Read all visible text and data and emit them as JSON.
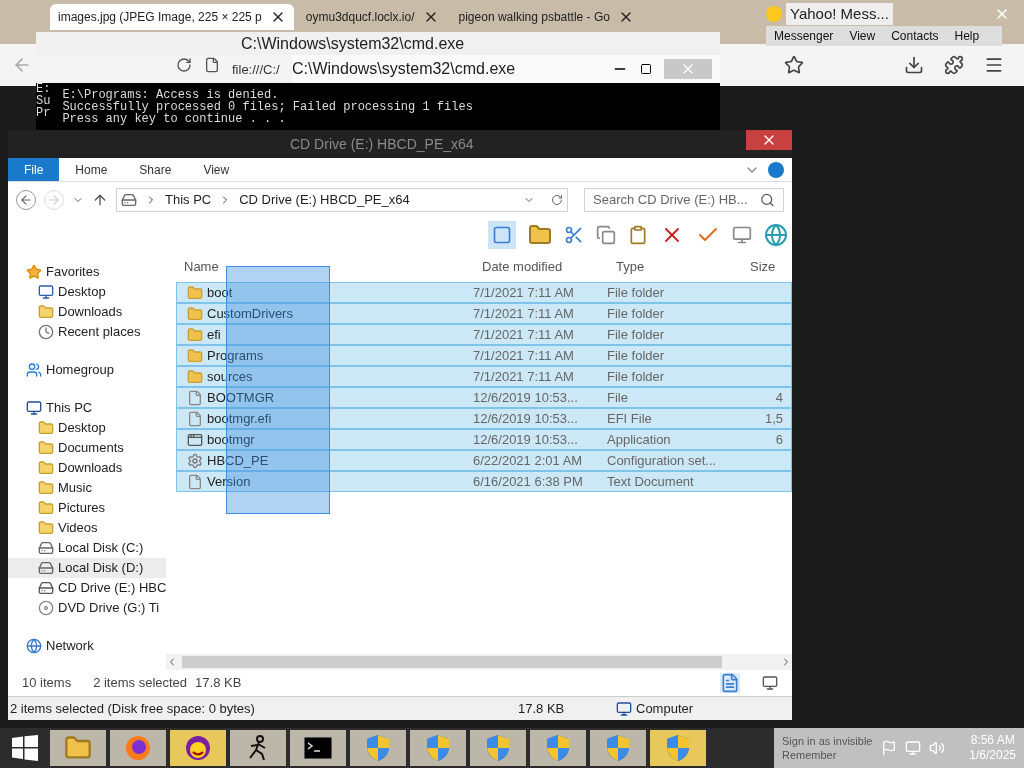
{
  "browser": {
    "tabs": [
      {
        "label": "images.jpg (JPEG Image, 225 × 225 p",
        "selected": true
      },
      {
        "label": "oymu3dqucf.loclx.io/",
        "selected": false
      },
      {
        "label": "pigeon walking psbattle - Go",
        "selected": false
      }
    ],
    "address": "file:///C:/"
  },
  "messenger": {
    "title": "Yahoo! Mess...",
    "menu": [
      "Messenger",
      "View",
      "Contacts",
      "Help"
    ]
  },
  "console_windows": [
    {
      "title": "C:\\Windows\\system32\\cmd.exe"
    },
    {
      "title": "C:\\Windows\\system32\\cmd.exe"
    }
  ],
  "console": {
    "hidden_lines": [
      "E:",
      "Su",
      "Pr"
    ],
    "lines": [
      "E:\\Programs: Access is denied.",
      "Successfully processed 0 files; Failed processing 1 files",
      "Press any key to continue . . ."
    ]
  },
  "explorer": {
    "title": "CD Drive (E:) HBCD_PE_x64",
    "ribbon_tabs": [
      {
        "label": "File",
        "selected": true
      },
      {
        "label": "Home",
        "selected": false
      },
      {
        "label": "Share",
        "selected": false
      },
      {
        "label": "View",
        "selected": false
      }
    ],
    "breadcrumb": [
      "This PC",
      "CD Drive (E:) HBCD_PE_x64"
    ],
    "search": {
      "placeholder": "Search CD Drive (E:) HB..."
    },
    "sidebar": [
      {
        "label": "Favorites",
        "kind": "star",
        "selected": false,
        "children": [
          {
            "label": "Desktop",
            "kind": "desktop",
            "selected": false
          },
          {
            "label": "Downloads",
            "kind": "folder",
            "selected": false
          },
          {
            "label": "Recent places",
            "kind": "recent",
            "selected": false
          }
        ]
      },
      {
        "label": "Homegroup",
        "kind": "homegroup",
        "selected": false
      },
      {
        "label": "This PC",
        "kind": "pc",
        "selected": false,
        "children": [
          {
            "label": "Desktop",
            "kind": "folder",
            "selected": false
          },
          {
            "label": "Documents",
            "kind": "folder",
            "selected": false
          },
          {
            "label": "Downloads",
            "kind": "folder",
            "selected": false
          },
          {
            "label": "Music",
            "kind": "folder",
            "selected": false
          },
          {
            "label": "Pictures",
            "kind": "folder",
            "selected": false
          },
          {
            "label": "Videos",
            "kind": "folder",
            "selected": false
          },
          {
            "label": "Local Disk (C:)",
            "kind": "disk",
            "selected": false
          },
          {
            "label": "Local Disk (D:)",
            "kind": "disk",
            "selected": true
          },
          {
            "label": "CD Drive (E:) HBC",
            "kind": "cd",
            "selected": false
          },
          {
            "label": "DVD Drive (G:) Ti",
            "kind": "dvd",
            "selected": false
          }
        ]
      },
      {
        "label": "Network",
        "kind": "network",
        "selected": false
      }
    ],
    "columns": [
      "Name",
      "Date modified",
      "Type",
      "Size"
    ],
    "rows": [
      {
        "name": "boot",
        "date": "7/1/2021 7:11 AM",
        "type": "File folder",
        "kind": "folder",
        "selected": true
      },
      {
        "name": "CustomDrivers",
        "date": "7/1/2021 7:11 AM",
        "type": "File folder",
        "kind": "folder",
        "selected": true
      },
      {
        "name": "efi",
        "date": "7/1/2021 7:11 AM",
        "type": "File folder",
        "kind": "folder",
        "selected": true
      },
      {
        "name": "Programs",
        "date": "7/1/2021 7:11 AM",
        "type": "File folder",
        "kind": "folder",
        "selected": true
      },
      {
        "name": "sources",
        "date": "7/1/2021 7:11 AM",
        "type": "File folder",
        "kind": "folder",
        "selected": true
      },
      {
        "name": "BOOTMGR",
        "date": "12/6/2019 10:53...",
        "type": "File",
        "size": "4",
        "kind": "file",
        "selected": true
      },
      {
        "name": "bootmgr.efi",
        "date": "12/6/2019 10:53...",
        "type": "EFI File",
        "size": "1,5",
        "kind": "file",
        "selected": true
      },
      {
        "name": "bootmgr",
        "date": "12/6/2019 10:53...",
        "type": "Application",
        "size": "6",
        "kind": "app",
        "selected": true
      },
      {
        "name": "HBCD_PE",
        "date": "6/22/2021 2:01 AM",
        "type": "Configuration set...",
        "kind": "config",
        "selected": true
      },
      {
        "name": "Version",
        "date": "6/16/2021 6:38 PM",
        "type": "Text Document",
        "kind": "file",
        "selected": true
      }
    ],
    "summary": {
      "items": "10 items",
      "selected": "2 items selected",
      "size": "17.8 KB"
    },
    "status_bar": [
      "2 items selected (Disk free space: 0 bytes)",
      "17.8 KB",
      "Computer"
    ]
  },
  "taskbar": {
    "apps": [
      {
        "kind": "folder",
        "selected": false
      },
      {
        "kind": "browser",
        "selected": false
      },
      {
        "kind": "messenger",
        "selected": true
      },
      {
        "kind": "runner",
        "selected": false
      },
      {
        "kind": "console",
        "selected": false
      },
      {
        "kind": "shield",
        "selected": false
      },
      {
        "kind": "shield",
        "selected": false
      },
      {
        "kind": "shield",
        "selected": false
      },
      {
        "kind": "shield",
        "selected": false
      },
      {
        "kind": "shield",
        "selected": false
      },
      {
        "kind": "shield",
        "selected": true
      }
    ],
    "ghost_lines": [
      "Sign in as invisible",
      "Remember"
    ],
    "time": "8:56 AM",
    "date": "1/6/2025"
  }
}
